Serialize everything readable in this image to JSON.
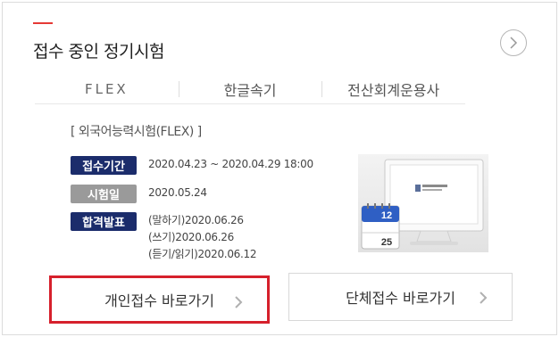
{
  "panel": {
    "title": "접수 중인 정기시험",
    "accent_color": "#e53935"
  },
  "tabs": [
    {
      "label": "FLEX"
    },
    {
      "label": "한글속기"
    },
    {
      "label": "전산회계운용사"
    }
  ],
  "exam": {
    "name": "[ 외국어능력시험(FLEX) ]",
    "rows": [
      {
        "badge": "접수기간",
        "badge_color": "#1b2c6b",
        "lines": [
          "2020.04.23 ~ 2020.04.29 18:00"
        ]
      },
      {
        "badge": "시험일",
        "badge_color": "#9a9a9a",
        "lines": [
          "2020.05.24"
        ]
      },
      {
        "badge": "합격발표",
        "badge_color": "#1b2c6b",
        "lines": [
          "(말하기)2020.06.26",
          "(쓰기)2020.06.26",
          "(듣기/읽기)2020.06.12"
        ]
      }
    ]
  },
  "illustration": {
    "calendar_top": "12",
    "calendar_bottom": "25"
  },
  "buttons": {
    "individual": "개인접수 바로가기",
    "group": "단체접수 바로가기",
    "highlight_color": "#d6202c"
  }
}
